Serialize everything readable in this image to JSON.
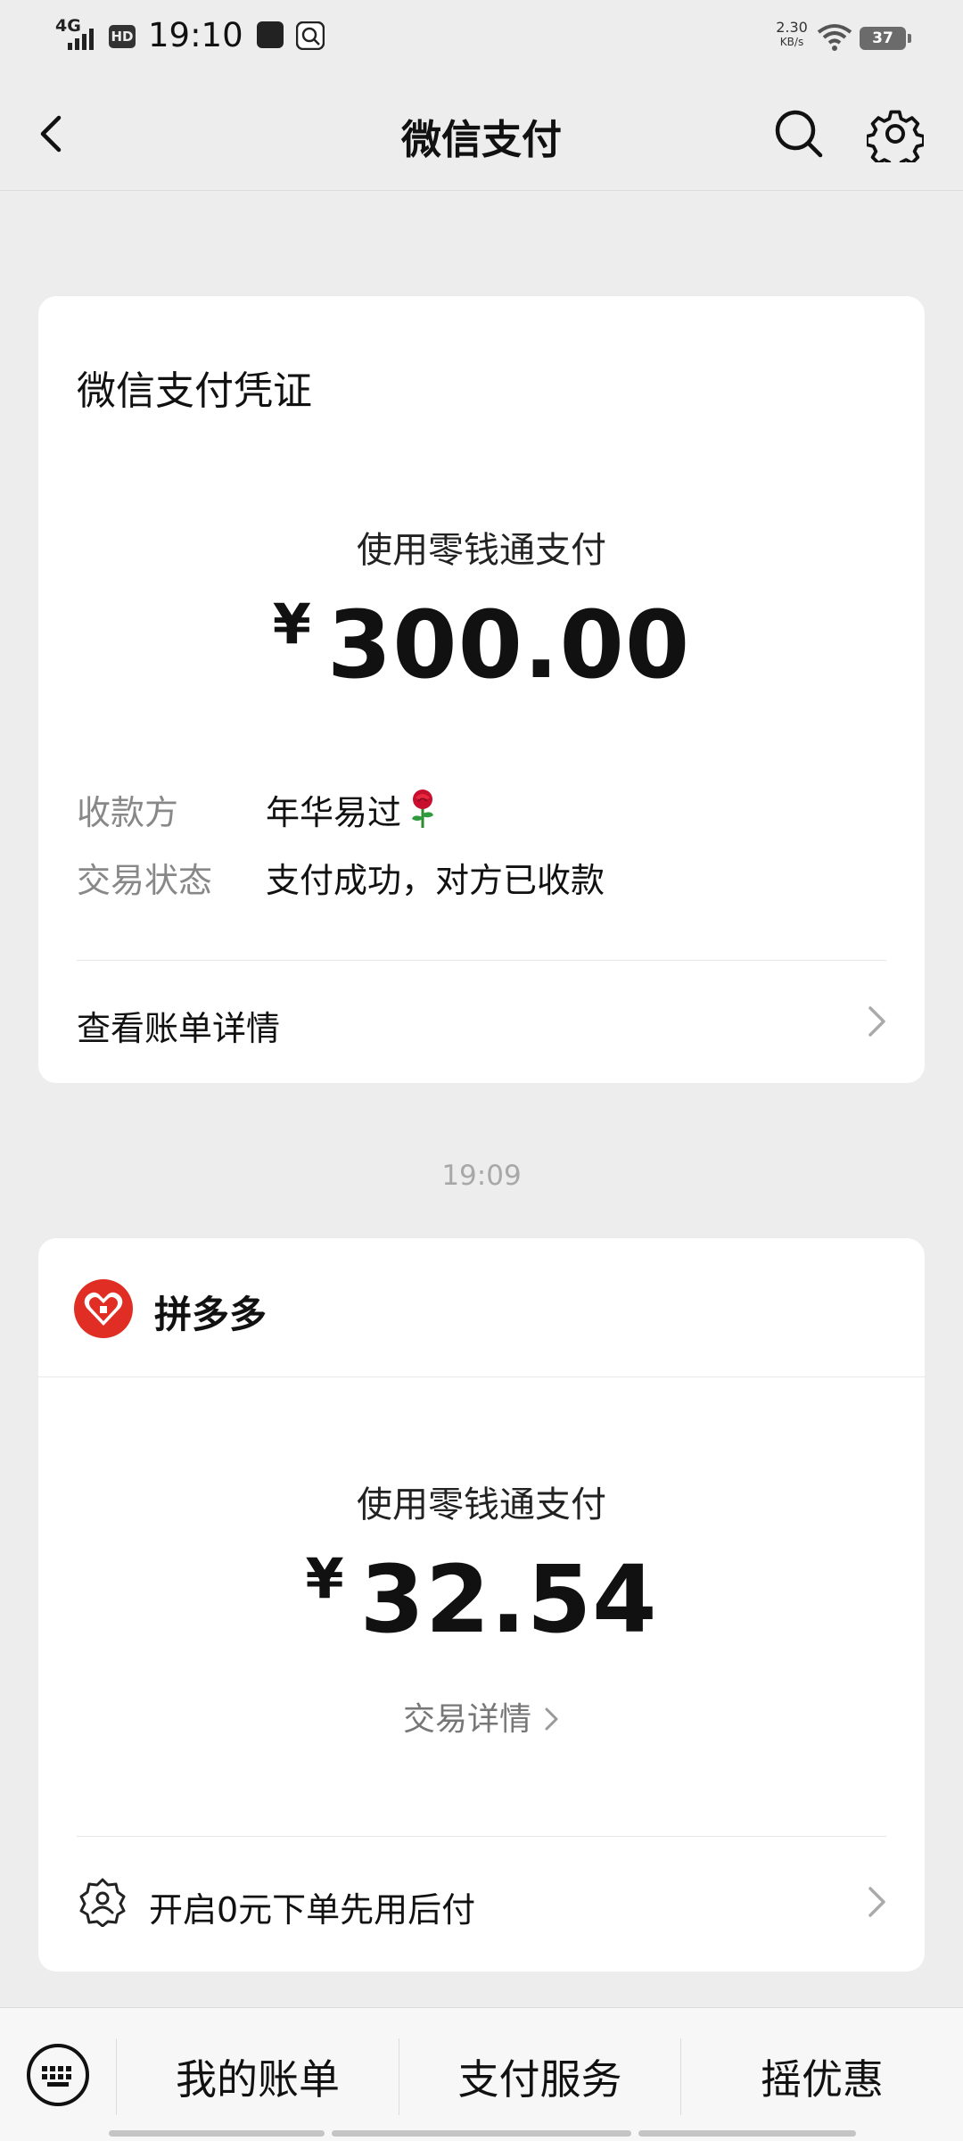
{
  "status_bar": {
    "network": "4G",
    "hd_badge": "HD",
    "time": "19:10",
    "speed_value": "2.30",
    "speed_unit": "KB/s",
    "battery": "37"
  },
  "nav": {
    "title": "微信支付",
    "back_icon": "chevron-left-icon",
    "search_icon": "search-icon",
    "settings_icon": "gear-icon"
  },
  "receipt": {
    "title": "微信支付凭证",
    "payment_method": "使用零钱通支付",
    "currency": "¥",
    "amount": "300.00",
    "payee_label": "收款方",
    "payee_value": "年华易过",
    "status_label": "交易状态",
    "status_value": "支付成功，对方已收款",
    "detail_link": "查看账单详情"
  },
  "timestamp": "19:09",
  "merchant_card": {
    "merchant": "拼多多",
    "payment_method": "使用零钱通支付",
    "currency": "¥",
    "amount": "32.54",
    "detail_link": "交易详情",
    "promo_text": "开启0元下单先用后付"
  },
  "bottom_bar": {
    "items": [
      "我的账单",
      "支付服务",
      "摇优惠"
    ]
  },
  "colors": {
    "background": "#ededed",
    "card": "#ffffff",
    "pdd_red": "#e02e24",
    "muted_text": "#888888"
  }
}
